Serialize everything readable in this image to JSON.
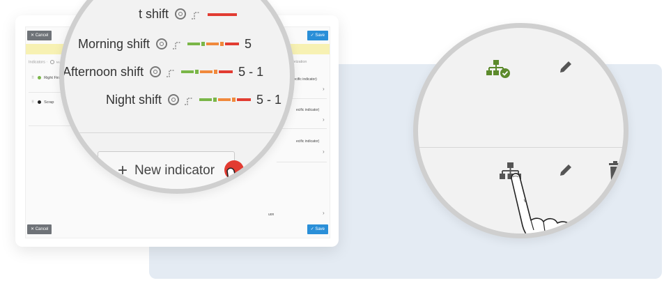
{
  "app_window": {
    "cancel_label": "Cancel",
    "save_label": "Save",
    "indicators_header": "Indicators ·",
    "indicators_header_sub": "Morning",
    "valorization_header": "ll and valorization",
    "items": [
      {
        "label": "Right First T",
        "dot_color": "#7ab648"
      },
      {
        "label": "Scrap",
        "dot_color": "#222222"
      }
    ],
    "right_items": [
      {
        "label": "l (specific indicator)"
      },
      {
        "label": "ecific indicator)"
      },
      {
        "label": "ecific indicator)"
      },
      {
        "label": "uon"
      }
    ],
    "footer_cancel_label": "Cancel",
    "footer_save_label": "Save"
  },
  "magnifier_left": {
    "shifts": [
      {
        "label": "t shift",
        "score": ""
      },
      {
        "label": "Morning shift",
        "score": "5"
      },
      {
        "label": "Afternoon shift",
        "score": "5 - 1"
      },
      {
        "label": "Night shift",
        "score": "5 - 1"
      }
    ],
    "new_indicator_label": "New indicator",
    "plus_symbol": "+"
  },
  "colors": {
    "green": "#7ab648",
    "orange": "#f0893c",
    "red": "#e23c32",
    "accent_blue": "#2a8fd8",
    "background_panel": "#e4ebf3"
  },
  "icons": {
    "hierarchy_check": "hierarchy-check-icon",
    "pencil": "pencil-icon",
    "trash": "trash-icon",
    "hierarchy": "hierarchy-icon",
    "hand_pointer": "hand-pointer-icon",
    "target": "target-icon",
    "step": "step-icon"
  }
}
